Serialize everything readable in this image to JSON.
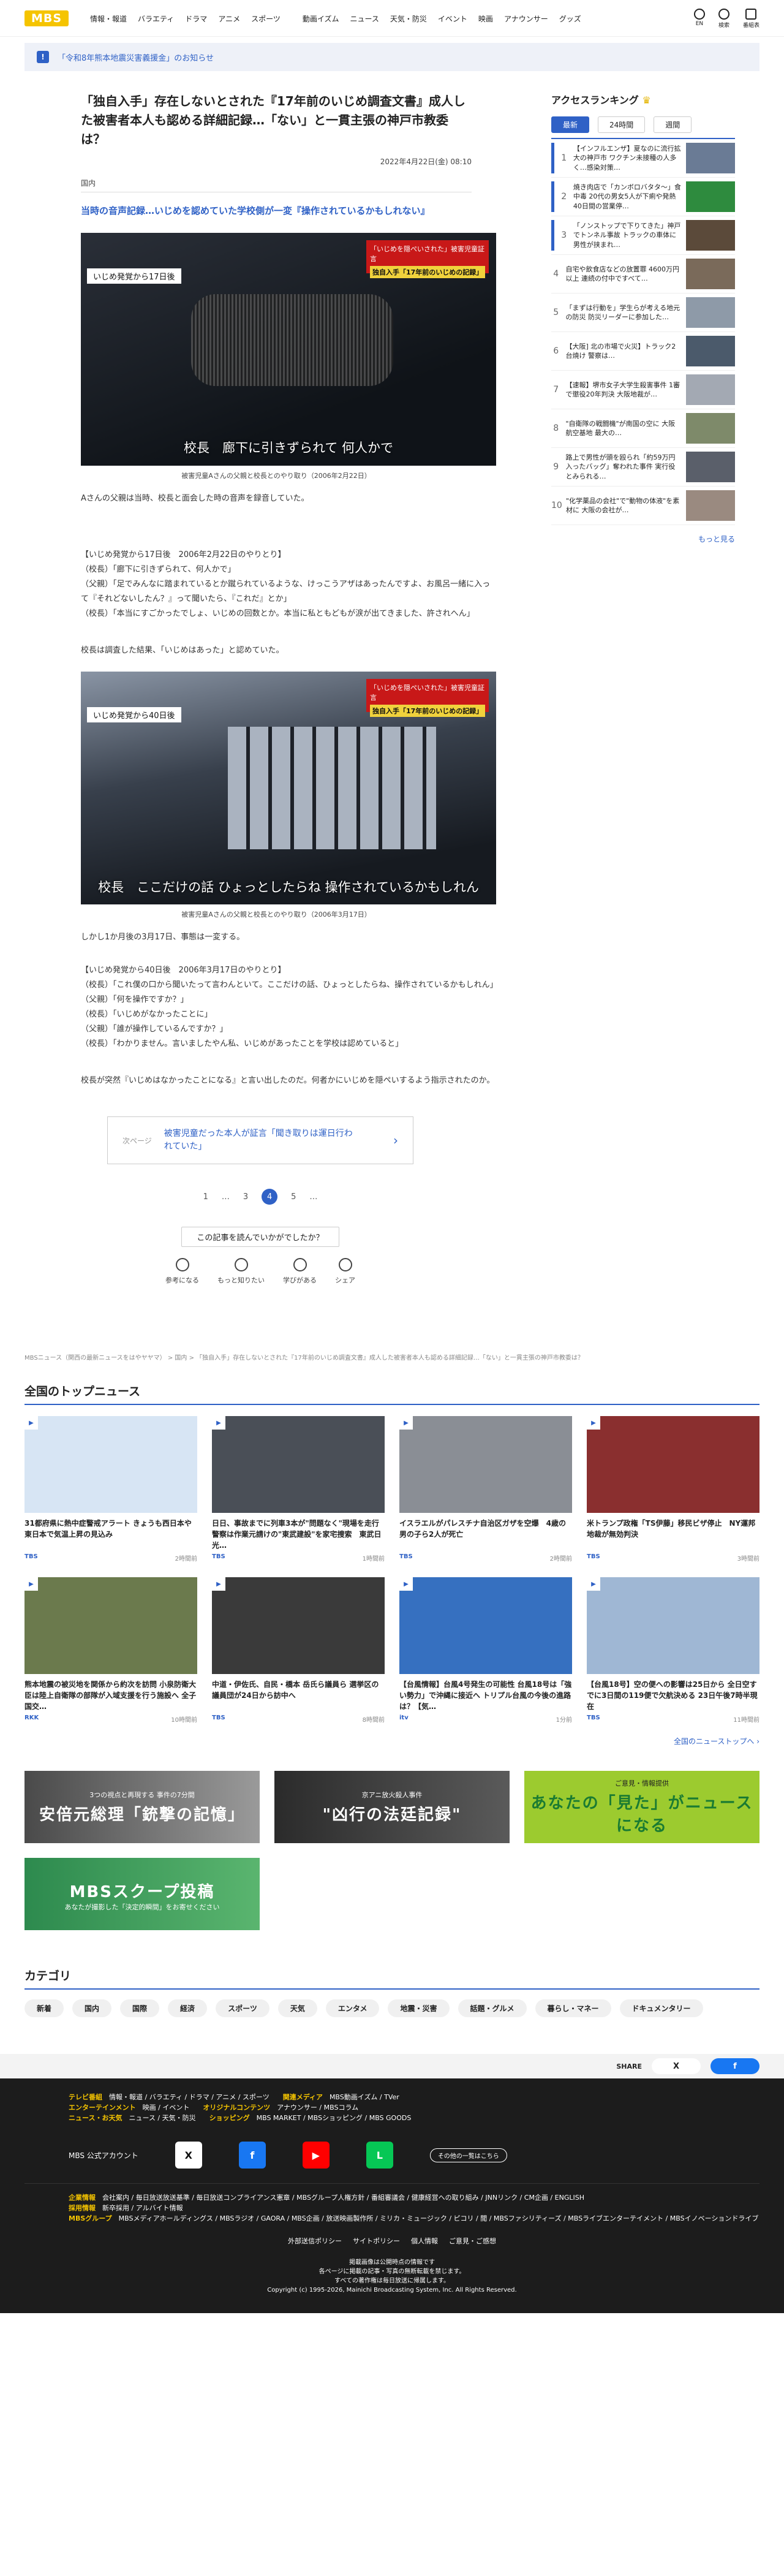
{
  "header": {
    "logo": "MBS",
    "nav": [
      "情報・報道",
      "バラエティ",
      "ドラマ",
      "アニメ",
      "スポーツ",
      "動画イズム",
      "ニュース",
      "天気・防災",
      "イベント",
      "映画",
      "アナウンサー",
      "グッズ"
    ],
    "icons": [
      {
        "name": "globe-icon",
        "label": "EN"
      },
      {
        "name": "search-icon",
        "label": "検索"
      },
      {
        "name": "program-icon",
        "label": "番組表"
      }
    ]
  },
  "notice": {
    "icon": "!",
    "text": "「令和8年熊本地震災害義援金」のお知らせ"
  },
  "article": {
    "title": "「独自入手」存在しないとされた『17年前のいじめ調査文書』成人した被害者本人も認める詳細記録…「ない」と一貫主張の神戸市教委は？",
    "date": "2022年4月22日(金) 08:10",
    "category": "国内",
    "lead": "当時の音声記録…いじめを認めていた学校側が一変『操作されているかもしれない』",
    "photo1": {
      "tag": "いじめ発覚から17日後",
      "badge": "「いじめを隠ぺいされた」被害児童証言",
      "badge2": "独自入手「17年前のいじめの記録」",
      "caption": "校長　廊下に引きずられて 何人かで",
      "figcap": "被害児童Aさんの父親と校長とのやり取り（2006年2月22日）"
    },
    "p1": "Aさんの父親は当時、校長と面会した時の音声を録音していた。",
    "p2": [
      "【いじめ発覚から17日後　2006年2月22日のやりとり】",
      "（校長）「廊下に引きずられて、何人かで」",
      "（父親）「足でみんなに踏まれているとか蹴られているような、けっこうアザはあったんですよ、お風呂一緒に入って『それどないしたん？』って聞いたら、『これだ』とか」",
      "（校長）「本当にすごかったでしょ、いじめの回数とか。本当に私ともどもが涙が出てきました、許されへん」"
    ],
    "p3": "校長は調査した結果、「いじめはあった」と認めていた。",
    "photo2": {
      "tag": "いじめ発覚から40日後",
      "badge": "「いじめを隠ぺいされた」被害児童証言",
      "badge2": "独自入手「17年前のいじめの記録」",
      "caption": "校長　ここだけの話 ひょっとしたらね 操作されているかもしれん",
      "figcap": "被害児童Aさんの父親と校長とのやり取り（2006年3月17日）"
    },
    "p4": "しかし1か月後の3月17日、事態は一変する。",
    "p5": [
      "【いじめ発覚から40日後　2006年3月17日のやりとり】",
      "（校長）「これ僕の口から聞いたって言わんといて。ここだけの話、ひょっとしたらね、操作されているかもしれん」",
      "（父親）「何を操作ですか？」",
      "（校長）「いじめがなかったことに」",
      "（父親）「誰が操作しているんですか？」",
      "（校長）「わかりません。言いましたやん私、いじめがあったことを学校は認めていると」"
    ],
    "p6": "校長が突然『いじめはなかったことになる』と言い出したのだ。何者かにいじめを隠ぺいするよう指示されたのか。",
    "next": {
      "label": "次ページ",
      "text": "被害児童だった本人が証言「聞き取りは運日行われていた」"
    },
    "pager": [
      "1",
      "…",
      "3",
      "4",
      "5",
      "…"
    ],
    "pager_current": "4",
    "react": {
      "question": "この記事を読んでいかがでしたか？",
      "buttons": [
        {
          "icon": "bulb-icon",
          "label": "参考になる"
        },
        {
          "icon": "magnifier-icon",
          "label": "もっと知りたい"
        },
        {
          "icon": "book-icon",
          "label": "学びがある"
        },
        {
          "icon": "share-icon",
          "label": "シェア"
        }
      ]
    }
  },
  "ranking": {
    "title": "アクセスランキング",
    "tabs": [
      "最新",
      "24時間",
      "週間"
    ],
    "items": [
      {
        "n": "1",
        "t": "【インフルエンザ】夏なのに流行拡大の神戸市 ワクチン未接種の人多く…感染対策…"
      },
      {
        "n": "2",
        "t": "焼き肉店で「カンボロバタタ～」食中毒 20代の男女5人が下痢や発熱 40日間の営業停…"
      },
      {
        "n": "3",
        "t": "「ノンストップで下りてきた」神戸でトンネル事故 トラックの車体に男性が挟まれ…"
      },
      {
        "n": "4",
        "t": "自宅や飲食店などの放置罪 4600万円以上 連続の付中ですべて…"
      },
      {
        "n": "5",
        "t": "「まずは行動を」学生らが考える地元の防災 防災リーダーに参加した…"
      },
      {
        "n": "6",
        "t": "【大阪] 北の市場で火災】トラック2台焼け 警察は…"
      },
      {
        "n": "7",
        "t": "【速報】堺市女子大学生殺害事件 1審で懲役20年判決 大阪地裁が…"
      },
      {
        "n": "8",
        "t": "\"自衛隊の戦闘機\"が南国の空に 大阪航空基地 最大の…"
      },
      {
        "n": "9",
        "t": "路上で男性が頭を殴られ「約59万円入ったバッグ」奪われた事件 実行役とみられる…"
      },
      {
        "n": "10",
        "t": "\"化学薬品の会社\"で\"動物の体液\"を素材に 大阪の会社が…"
      }
    ],
    "more": "もっと見る"
  },
  "breadcrumb": "MBSニュース（関西の最新ニュースをはやヤヤマ） > 国内 > 「独自入手」存在しないとされた『17年前のいじめ調査文書』成人した被害者本人も認める詳細記録…「ない」と一貫主張の神戸市教委は？",
  "topnews": {
    "title": "全国のトップニュース",
    "items": [
      {
        "t": "31都府県に熱中症警戒アラート きょうも西日本や東日本で気温上昇の見込み",
        "src": "TBS",
        "time": "2時間前",
        "c": "#d7e5f4"
      },
      {
        "t": "日日、事故までに列車3本が\"問題なく\"現場を走行　警察は作業元請けの\"東武建設\"を家宅捜索　東武日光…",
        "src": "TBS",
        "time": "1時間前",
        "c": "#4a4f57"
      },
      {
        "t": "イスラエルがパレスチナ自治区ガザを空爆　4歳の男の子ら2人が死亡",
        "src": "TBS",
        "time": "2時間前",
        "c": "#8a8e95"
      },
      {
        "t": "米トランプ政権「TS伊藤」移民ビザ停止　NY運邦地裁が無効判決",
        "src": "TBS",
        "time": "3時間前",
        "c": "#8a2f2f"
      },
      {
        "t": "熊本地震の被災地を関係から約次を訪問 小泉防衛大臣は陸上自衛隊の部隊が入域支援を行う施設へ 全子国交…",
        "src": "RKK",
        "time": "10時間前",
        "c": "#6b7a4d"
      },
      {
        "t": "中道・伊佐氏、自民・橋本 岳氏ら議員ら 選挙区の議員団が24日から訪中へ",
        "src": "TBS",
        "time": "8時間前",
        "c": "#3a3a3a"
      },
      {
        "t": "【台風情報】台風4号発生の可能性 台風18号は「強い勢力」で沖縄に接近へ トリプル台風の今後の進路は？【気…",
        "src": "itv",
        "time": "1分前",
        "c": "#3670c0"
      },
      {
        "t": "【台風18号】空の便への影響は25日から 全日空すでに3日間の119便で欠航決める 23日午後7時半現在",
        "src": "TBS",
        "time": "11時間前",
        "c": "#9fb7d4"
      }
    ],
    "all": "全国のニューストップへ ›"
  },
  "banners": [
    {
      "s": "3つの視点と再現する 事件の7分間",
      "b": "安倍元総理「銃撃の記憶」"
    },
    {
      "s": "京アニ放火殺人事件",
      "b": "\"凶行の法廷記録\""
    },
    {
      "s": "ご意見・情報提供",
      "b": "あなたの「見た」がニュースになる"
    },
    {
      "s": "あなたが撮影した「決定的瞬間」をお寄せください",
      "b": "MBSスクープ投稿"
    }
  ],
  "categories": {
    "title": "カテゴリ",
    "items": [
      "新着",
      "国内",
      "国際",
      "経済",
      "スポーツ",
      "天気",
      "エンタメ",
      "地震・災害",
      "話題・グルメ",
      "暮らし・マネー",
      "ドキュメンタリー"
    ]
  },
  "share": {
    "label": "SHARE",
    "x": "X",
    "fb": "f"
  },
  "footer": {
    "rows": [
      [
        {
          "k": "テレビ番組",
          "v": "情報・報道 / バラエティ / ドラマ / アニメ / スポーツ"
        },
        {
          "k": "関連メディア",
          "v": "MBS動画イズム / TVer"
        }
      ],
      [
        {
          "k": "エンターテインメント",
          "v": "映画 / イベント"
        },
        {
          "k": "オリジナルコンテンツ",
          "v": "アナウンサー / MBSコラム"
        }
      ],
      [
        {
          "k": "ニュース・お天気",
          "v": "ニュース / 天気・防災"
        },
        {
          "k": "ショッピング",
          "v": "MBS MARKET / MBSショッピング / MBS GOODS"
        }
      ]
    ],
    "sns_label": "MBS 公式アカウント",
    "sns_more": "その他の一覧はこちら",
    "links": [
      {
        "k": "企業情報",
        "v": "会社案内 / 毎日放送放送基準 / 毎日放送コンプライアンス憲章 / MBSグループ人権方針 / 番組審議会 / 健康経営への取り組み / JNNリンク / CM企画 / ENGLISH"
      },
      {
        "k": "採用情報",
        "v": "新卒採用 / アルバイト情報"
      },
      {
        "k": "MBSグループ",
        "v": "MBSメディアホールディングス / MBSラジオ / GAORA / MBS企画 / 放送映画製作所 / ミリカ・ミュージック / ピコリ / 閲 / MBSファシリティーズ / MBSライブエンターテイメント / MBSイノベーションドライブ"
      }
    ],
    "bottom": [
      "外部送信ポリシー",
      "サイトポリシー",
      "個人情報",
      "ご意見・ご感想"
    ],
    "copy": [
      "掲載画像は公開時点の情報です",
      "各ページに掲載の記事・写真の無断転載を禁じます。",
      "すべての著作権は毎日放送に帰属します。",
      "Copyright (c) 1995-2026, Mainichi Broadcasting System, Inc. All Rights Reserved."
    ]
  }
}
